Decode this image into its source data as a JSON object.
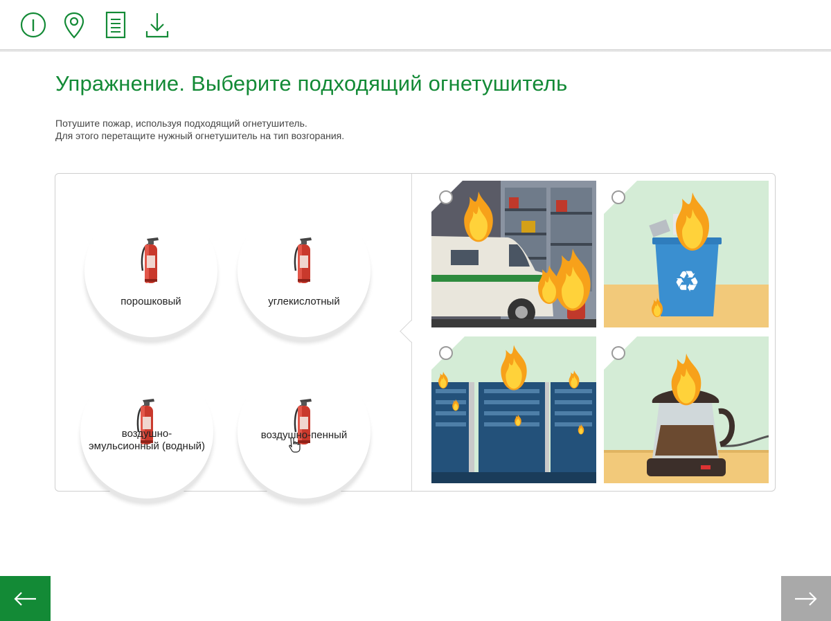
{
  "toolbar": {
    "icons": [
      "info-icon",
      "map-pin-icon",
      "document-icon",
      "download-icon"
    ],
    "accent": "#138a36"
  },
  "page": {
    "title": "Упражнение. Выберите подходящий огнетушитель",
    "instructions": [
      "Потушите пожар, используя подходящий огнетушитель.",
      "Для этого перетащите нужный огнетушитель на тип возгорания."
    ]
  },
  "extinguishers": [
    {
      "label": "порошковый"
    },
    {
      "label": "углекислотный"
    },
    {
      "label": "воздушно-эмульсионный (водный)"
    },
    {
      "label": "воздушно-пенный"
    }
  ],
  "fire_types": [
    {
      "scene": "garage-vehicle-fire"
    },
    {
      "scene": "trash-bin-fire"
    },
    {
      "scene": "server-rack-fire"
    },
    {
      "scene": "electric-kettle-fire"
    }
  ],
  "nav": {
    "prev_icon": "arrow-left-icon",
    "next_icon": "arrow-right-icon",
    "prev_color": "#138a36",
    "next_color": "#a9a9a9"
  }
}
